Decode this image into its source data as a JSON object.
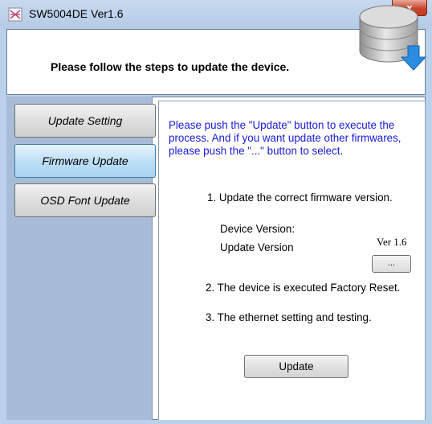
{
  "window": {
    "title": "SW5004DE Ver1.6",
    "close_label": "x"
  },
  "header": {
    "message": "Please follow the steps to update the device."
  },
  "nav": {
    "items": [
      {
        "label": "Update Setting",
        "active": false
      },
      {
        "label": "Firmware Update",
        "active": true
      },
      {
        "label": "OSD Font Update",
        "active": false
      }
    ]
  },
  "content": {
    "intro": "Please push the \"Update\" button to execute the process. And if you want update other firmwares, please push the \"...\" button to select.",
    "step1": "1. Update the correct firmware version.",
    "device_version_label": "Device Version:",
    "update_version_label": "Update Version",
    "update_version_value": "Ver 1.6",
    "browse_label": "...",
    "step2": "2. The device is executed Factory Reset.",
    "step3": "3. The ethernet setting and testing.",
    "update_button": "Update"
  },
  "colors": {
    "intro_text": "#1a1ad8",
    "nav_background": "#a7bcd6",
    "active_tab": "#bfe0f6"
  }
}
